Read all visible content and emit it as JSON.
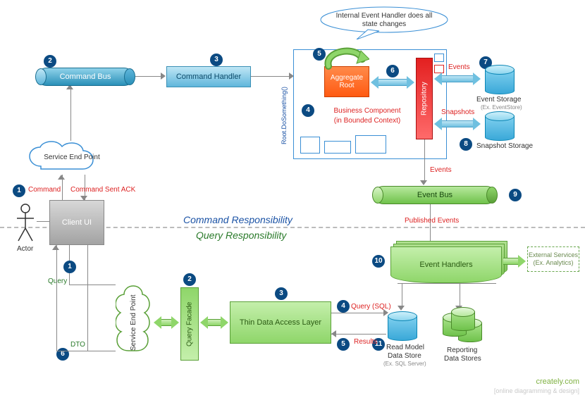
{
  "nodes": {
    "command_bus": "Command Bus",
    "command_handler": "Command Handler",
    "service_end_point_top": "Service End Point",
    "client_ui": "Client  UI",
    "actor": "Actor",
    "aggregate_root": "Aggregate\nRoot",
    "repository": "Repository",
    "business_component_l1": "Business Component",
    "business_component_l2": "(in Bounded Context)",
    "event_storage": "Event Storage",
    "event_storage_sub": "(Ex. EventStore)",
    "snapshot_storage": "Snapshot Storage",
    "event_bus": "Event Bus",
    "event_handlers": "Event Handlers",
    "external_services_l1": "External Services",
    "external_services_l2": "(Ex. Analytics)",
    "service_end_point_bottom": "Service End Point",
    "query_facade": "Query Facade",
    "thin_dal": "Thin Data Access Layer",
    "read_model_l1": "Read Model",
    "read_model_l2": "Data Store",
    "read_model_l3": "(Ex. SQL Server)",
    "reporting_l1": "Reporting",
    "reporting_l2": "Data Stores"
  },
  "annotations": {
    "callout": "Internal Event Handler does all state changes",
    "root_do_something": "Root.DoSomething()",
    "events": "Events",
    "snapshots": "Snapshots",
    "events_down": "Events",
    "published_events": "Published Events",
    "command": "Command",
    "command_sent_ack": "Command Sent ACK",
    "query": "Query",
    "dto": "DTO",
    "query_sql": "Query (SQL)",
    "results": "Results",
    "command_resp": "Command Responsibility",
    "query_resp": "Query Responsibility"
  },
  "badges": {
    "c1": "1",
    "c2": "2",
    "c3": "3",
    "c4": "4",
    "c5": "5",
    "c6": "6",
    "c7": "7",
    "c8": "8",
    "c9": "9",
    "c10": "10",
    "q1": "1",
    "q2": "2",
    "q3": "3",
    "q4": "4",
    "q5": "5",
    "q6": "6",
    "q11": "11"
  },
  "footer": {
    "brand": "creately.com",
    "tagline": "[online diagramming & design]"
  }
}
